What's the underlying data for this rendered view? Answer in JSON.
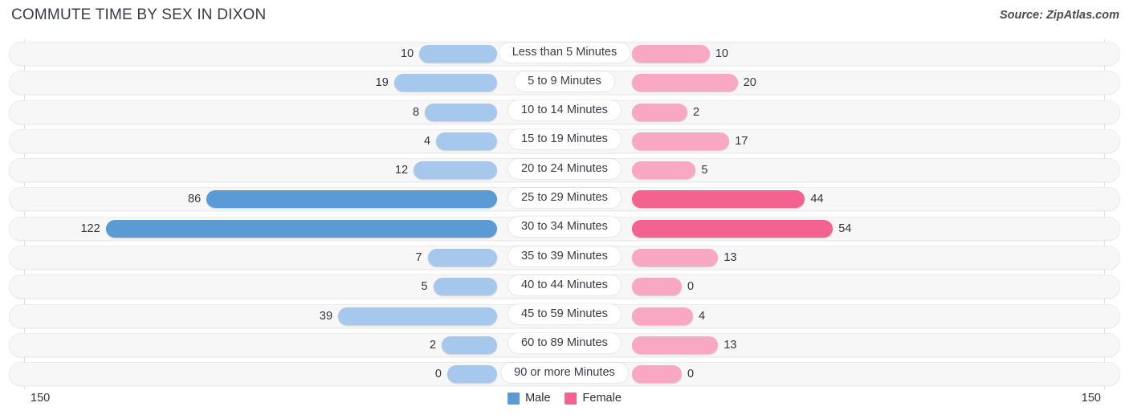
{
  "header": {
    "title": "COMMUTE TIME BY SEX IN DIXON",
    "source": "Source: ZipAtlas.com"
  },
  "axis": {
    "left_label": "150",
    "right_label": "150",
    "max": 150
  },
  "legend": {
    "items": [
      {
        "label": "Male",
        "color": "#5b9bd5"
      },
      {
        "label": "Female",
        "color": "#f4628f"
      }
    ]
  },
  "colors": {
    "male_light": "#a6c8ec",
    "male_dark": "#5b9bd5",
    "female_light": "#f9a8c4",
    "female_dark": "#f4628f",
    "track": "#f7f7f7",
    "gridline": "#e2e2e2",
    "text": "#33333e"
  },
  "chart_data": {
    "type": "bar",
    "orientation": "horizontal",
    "style": "diverging-bidirectional",
    "title": "COMMUTE TIME BY SEX IN DIXON",
    "source": "Source: ZipAtlas.com",
    "xlabel": "",
    "ylabel": "",
    "xlim": [
      150,
      150
    ],
    "grid": true,
    "legend_position": "bottom-center",
    "categories": [
      "Less than 5 Minutes",
      "5 to 9 Minutes",
      "10 to 14 Minutes",
      "15 to 19 Minutes",
      "20 to 24 Minutes",
      "25 to 29 Minutes",
      "30 to 34 Minutes",
      "35 to 39 Minutes",
      "40 to 44 Minutes",
      "45 to 59 Minutes",
      "60 to 89 Minutes",
      "90 or more Minutes"
    ],
    "series": [
      {
        "name": "Male",
        "color": "#5b9bd5",
        "values": [
          10,
          19,
          8,
          4,
          12,
          86,
          122,
          7,
          5,
          39,
          2,
          0
        ]
      },
      {
        "name": "Female",
        "color": "#f4628f",
        "values": [
          10,
          20,
          2,
          17,
          5,
          44,
          54,
          13,
          0,
          4,
          13,
          0
        ]
      }
    ]
  },
  "rows": [
    {
      "category": "Less than 5 Minutes",
      "male": 10,
      "male_text": "10",
      "female": 10,
      "female_text": "10"
    },
    {
      "category": "5 to 9 Minutes",
      "male": 19,
      "male_text": "19",
      "female": 20,
      "female_text": "20"
    },
    {
      "category": "10 to 14 Minutes",
      "male": 8,
      "male_text": "8",
      "female": 2,
      "female_text": "2"
    },
    {
      "category": "15 to 19 Minutes",
      "male": 4,
      "male_text": "4",
      "female": 17,
      "female_text": "17"
    },
    {
      "category": "20 to 24 Minutes",
      "male": 12,
      "male_text": "12",
      "female": 5,
      "female_text": "5"
    },
    {
      "category": "25 to 29 Minutes",
      "male": 86,
      "male_text": "86",
      "female": 44,
      "female_text": "44"
    },
    {
      "category": "30 to 34 Minutes",
      "male": 122,
      "male_text": "122",
      "female": 54,
      "female_text": "54"
    },
    {
      "category": "35 to 39 Minutes",
      "male": 7,
      "male_text": "7",
      "female": 13,
      "female_text": "13"
    },
    {
      "category": "40 to 44 Minutes",
      "male": 5,
      "male_text": "5",
      "female": 0,
      "female_text": "0"
    },
    {
      "category": "45 to 59 Minutes",
      "male": 39,
      "male_text": "39",
      "female": 4,
      "female_text": "4"
    },
    {
      "category": "60 to 89 Minutes",
      "male": 2,
      "male_text": "2",
      "female": 13,
      "female_text": "13"
    },
    {
      "category": "90 or more Minutes",
      "male": 0,
      "male_text": "0",
      "female": 0,
      "female_text": "0"
    }
  ]
}
